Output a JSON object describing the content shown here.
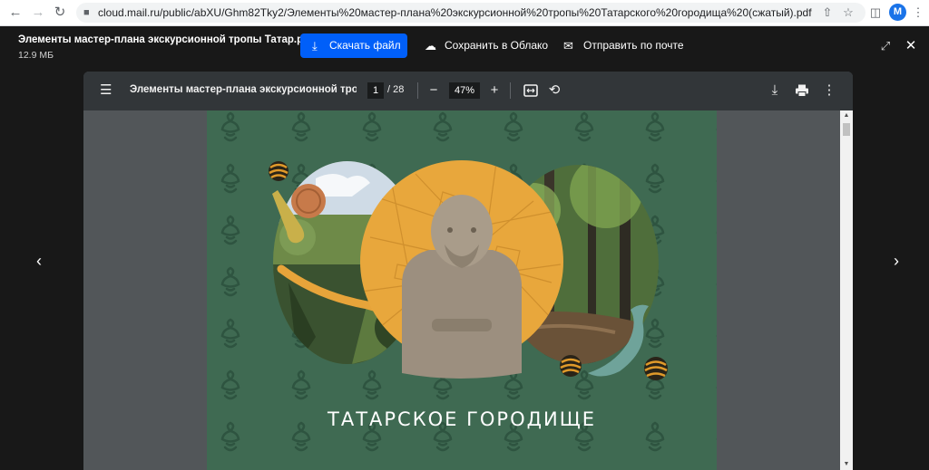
{
  "browser": {
    "url": "cloud.mail.ru/public/abXU/Ghm82Tky2/Элементы%20мастер-плана%20экскурсионной%20тропы%20Татарского%20городища%20(сжатый).pdf",
    "profile_initial": "M"
  },
  "viewer": {
    "file_name": "Элементы мастер-плана экскурсионной тропы Татар.pdf",
    "file_size": "12.9 МБ",
    "download_label": "Скачать файл",
    "save_cloud_label": "Сохранить в Облако",
    "send_mail_label": "Отправить по почте",
    "accent_color": "#005ff9"
  },
  "pdf": {
    "title": "Элементы мастер-плана экскурсионной тропы ...",
    "current_page": "1",
    "total_pages": "/ 28",
    "zoom": "47%",
    "page_heading": "ТАТАРСКОЕ ГОРОДИЩЕ"
  }
}
